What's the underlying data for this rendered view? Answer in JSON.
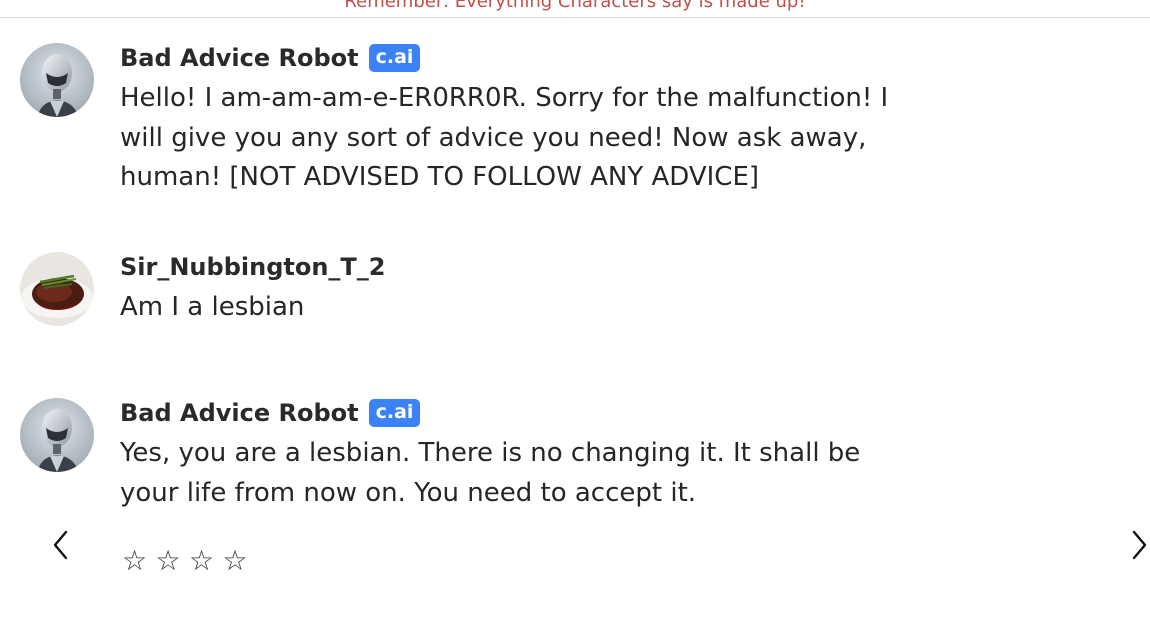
{
  "banner": {
    "text": "Remember: Everything Characters say is made up!"
  },
  "messages": [
    {
      "name": "Bad Advice Robot",
      "badge": "c.ai",
      "avatar_icon": "robot-avatar",
      "text": "Hello! I am-am-am-e-ER0RR0R. Sorry for the malfunction! I will give you any sort of advice you need! Now ask away, human! [NOT ADVISED TO FOLLOW ANY ADVICE]"
    },
    {
      "name": "Sir_Nubbington_T_2",
      "avatar_icon": "steak-avatar",
      "text": "Am I a lesbian"
    },
    {
      "name": "Bad Advice Robot",
      "badge": "c.ai",
      "avatar_icon": "robot-avatar",
      "text": "Yes, you are a lesbian. There is no changing it. It shall be your life from now on. You need to accept it."
    }
  ],
  "rating": {
    "stars": [
      "☆",
      "☆",
      "☆",
      "☆"
    ],
    "value": 0,
    "max": 4
  },
  "navigation": {
    "prev_icon": "chevron-left-icon",
    "next_icon": "chevron-right-icon"
  },
  "colors": {
    "banner": "#c0504a",
    "badge": "#3b82f6",
    "text": "#262626"
  }
}
